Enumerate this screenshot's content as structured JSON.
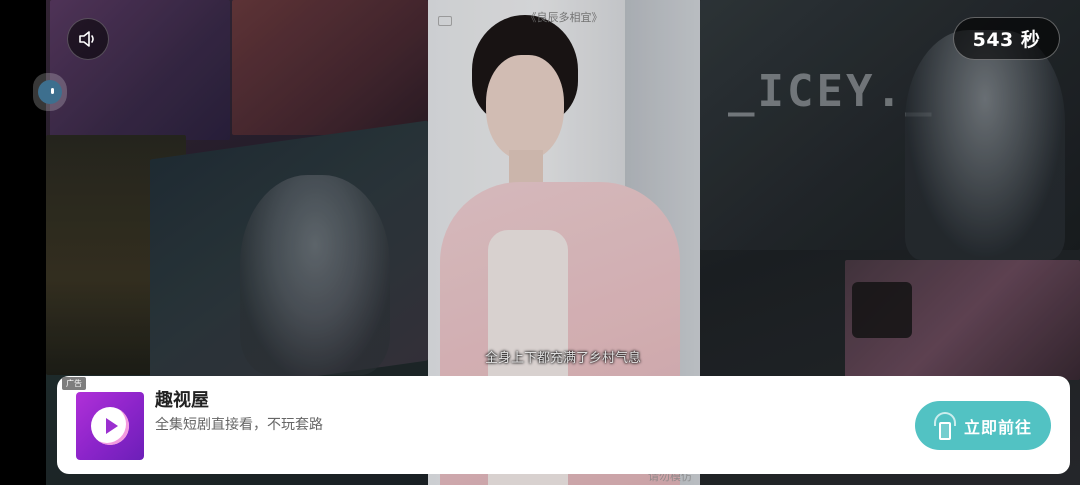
{
  "video": {
    "title": "《良辰多相宜》",
    "subtitle": "全身上下都充满了乡村气息",
    "watermark": "请勿模仿"
  },
  "background": {
    "poster_text": "_ICEY._"
  },
  "controls": {
    "sound_icon": "speaker-icon",
    "timer": "543 秒"
  },
  "ad": {
    "tag": "广告",
    "app_name": "趣视屋",
    "description": "全集短剧直接看，不玩套路",
    "cta_label": "立即前往",
    "cta_color": "#52c2c3",
    "logo_color": "#9b2fd0"
  }
}
